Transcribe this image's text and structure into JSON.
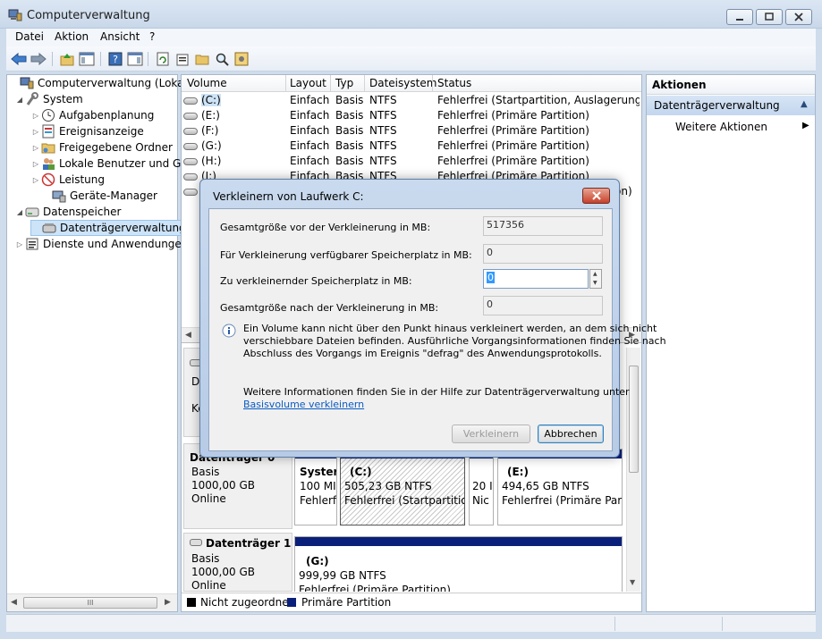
{
  "window": {
    "title": "Computerverwaltung",
    "minimize_icon": "minimize-icon",
    "maximize_icon": "maximize-icon",
    "close_icon": "close-icon"
  },
  "menu": {
    "items": [
      "Datei",
      "Aktion",
      "Ansicht",
      "?"
    ]
  },
  "toolbar": {
    "icons": [
      "back-arrow-icon",
      "forward-arrow-icon",
      "up-folder-icon",
      "show-hide-tree-icon",
      "help-icon",
      "show-hide-action-pane-icon",
      "refresh-icon",
      "properties-icon",
      "open-folder-icon",
      "search-icon",
      "settings-icon"
    ]
  },
  "tree": {
    "items": [
      {
        "label": "Computerverwaltung (Lokal)",
        "icon": "computer-management-icon"
      },
      {
        "label": "System",
        "icon": "tools-icon"
      },
      {
        "label": "Aufgabenplanung",
        "icon": "clock-icon"
      },
      {
        "label": "Ereignisanzeige",
        "icon": "event-viewer-icon"
      },
      {
        "label": "Freigegebene Ordner",
        "icon": "shared-folder-icon"
      },
      {
        "label": "Lokale Benutzer und Gru",
        "icon": "users-icon"
      },
      {
        "label": "Leistung",
        "icon": "performance-icon"
      },
      {
        "label": "Geräte-Manager",
        "icon": "device-manager-icon"
      },
      {
        "label": "Datenspeicher",
        "icon": "storage-icon"
      },
      {
        "label": "Datenträgerverwaltung",
        "icon": "disk-management-icon"
      },
      {
        "label": "Dienste und Anwendungen",
        "icon": "services-icon"
      }
    ],
    "scroll_thumb_label": "III"
  },
  "volumes": {
    "headers": [
      "Volume",
      "Layout",
      "Typ",
      "Dateisystem",
      "Status"
    ],
    "rows": [
      {
        "volume": "(C:)",
        "layout": "Einfach",
        "type": "Basis",
        "fs": "NTFS",
        "status": "Fehlerfrei (Startpartition, Auslagerungsdate"
      },
      {
        "volume": "(E:)",
        "layout": "Einfach",
        "type": "Basis",
        "fs": "NTFS",
        "status": "Fehlerfrei (Primäre Partition)"
      },
      {
        "volume": "(F:)",
        "layout": "Einfach",
        "type": "Basis",
        "fs": "NTFS",
        "status": "Fehlerfrei (Primäre Partition)"
      },
      {
        "volume": "(G:)",
        "layout": "Einfach",
        "type": "Basis",
        "fs": "NTFS",
        "status": "Fehlerfrei (Primäre Partition)"
      },
      {
        "volume": "(H:)",
        "layout": "Einfach",
        "type": "Basis",
        "fs": "NTFS",
        "status": "Fehlerfrei (Primäre Partition)"
      },
      {
        "volume": "(I:)",
        "layout": "Einfach",
        "type": "Basis",
        "fs": "NTFS",
        "status": "Fehlerfrei (Primäre Partition)"
      },
      {
        "volume": "S",
        "layout": "",
        "type": "",
        "fs": "",
        "status": "on)"
      }
    ]
  },
  "disks": {
    "cdrom": {
      "name": "DV",
      "status": "Ke"
    },
    "disk0": {
      "name": "Datenträger 0",
      "type": "Basis",
      "size": "1000,00 GB",
      "status": "Online",
      "partitions": [
        {
          "name": "Syster",
          "size": "100 MI",
          "status": "Fehlerf"
        },
        {
          "name": "(C:)",
          "size": "505,23 GB NTFS",
          "status": "Fehlerfrei (Startpartition,"
        },
        {
          "name": "",
          "size": "20 I",
          "status": "Nic"
        },
        {
          "name": "(E:)",
          "size": "494,65 GB NTFS",
          "status": "Fehlerfrei (Primäre Partit"
        }
      ]
    },
    "disk1": {
      "name": "Datenträger 1",
      "type": "Basis",
      "size": "1000,00 GB",
      "status": "Online",
      "partitions": [
        {
          "name": "(G:)",
          "size": "999,99 GB NTFS",
          "status": "Fehlerfrei (Primäre Partition)"
        }
      ]
    },
    "legend": [
      {
        "label": "Nicht zugeordnet",
        "color": "#000000"
      },
      {
        "label": "Primäre Partition",
        "color": "#0a1f7a"
      }
    ]
  },
  "actions": {
    "header": "Aktionen",
    "section": "Datenträgerverwaltung",
    "more": "Weitere Aktionen"
  },
  "dialog": {
    "title": "Verkleinern von Laufwerk C:",
    "fields": [
      {
        "label": "Gesamtgröße vor der Verkleinerung in MB:",
        "value": "517356"
      },
      {
        "label": "Für Verkleinerung verfügbarer Speicherplatz in MB:",
        "value": "0"
      },
      {
        "label": "Zu verkleinernder Speicherplatz in MB:",
        "value": "0"
      },
      {
        "label": "Gesamtgröße nach der Verkleinerung in MB:",
        "value": "0"
      }
    ],
    "info_icon": "info-icon",
    "info_text_1": "Ein Volume kann nicht über den Punkt hinaus verkleinert werden, an dem sich nicht",
    "info_text_2": "verschiebbare Dateien befinden. Ausführliche Vorgangsinformationen finden Sie nach",
    "info_text_3": "Abschluss des Vorgangs im Ereignis \"defrag\" des Anwendungsprotokolls.",
    "help_text": "Weitere Informationen finden Sie in der Hilfe zur Datenträgerverwaltung unter",
    "help_link": "Basisvolume verkleinern",
    "shrink_button": "Verkleinern",
    "cancel_button": "Abbrechen"
  },
  "colors": {
    "primary_partition": "#0a1f7a",
    "unallocated": "#000000",
    "selection": "#cde3f7"
  }
}
